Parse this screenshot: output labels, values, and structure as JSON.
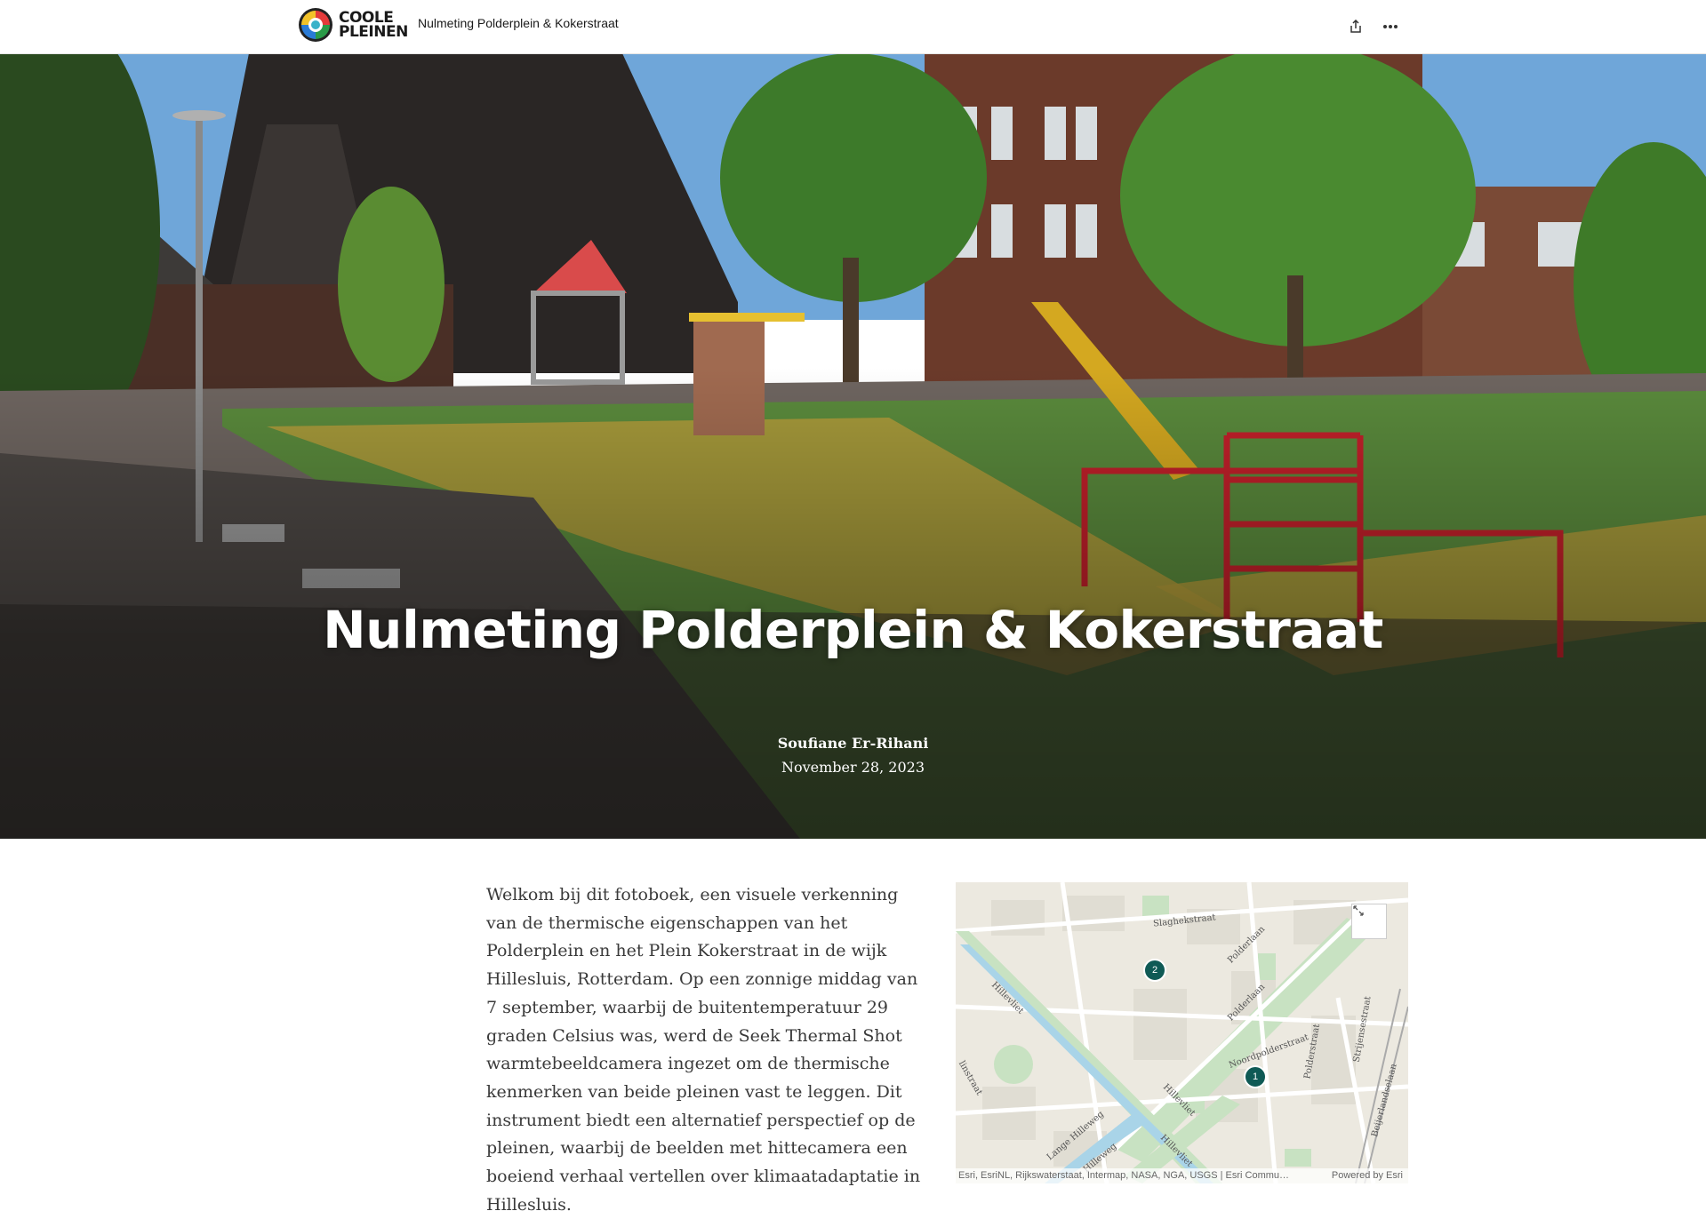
{
  "header": {
    "logo_line1": "COOLE",
    "logo_line2": "PLEINEN",
    "story_title": "Nulmeting Polderplein & Kokerstraat",
    "share_icon": "share-icon",
    "more_icon": "more-options-icon"
  },
  "hero": {
    "title": "Nulmeting Polderplein & Kokerstraat",
    "author": "Soufiane Er-Rihani",
    "date": "November 28, 2023"
  },
  "intro": {
    "text": "Welkom bij dit fotoboek, een visuele verkenning van de thermische eigenschappen van het Polderplein en het Plein Kokerstraat in de wijk Hillesluis, Rotterdam. Op een zonnige middag van 7 september, waarbij de buitentemperatuur 29 graden Celsius was, werd de Seek Thermal Shot warmtebeeldcamera ingezet om de thermische kenmerken van beide pleinen vast te leggen. Dit instrument biedt een alternatief perspectief op de pleinen, waarbij de beelden met hittecamera een boeiend verhaal vertellen over klimaatadaptatie in Hillesluis."
  },
  "map": {
    "expand_icon": "expand-icon",
    "markers": [
      "1",
      "2"
    ],
    "streets": {
      "slaghekstraat": "Slaghekstraat",
      "polderlaan1": "Polderlaan",
      "polderlaan2": "Polderlaan",
      "hillevliet1": "Hillevliet",
      "hillevliet2": "Hillevliet",
      "hillevliet3": "Hillevliet",
      "noordpolderstraat": "Noordpolderstraat",
      "polderstraat": "Polderstraat",
      "strijensestraat": "Strijensestraat",
      "beijerlandselaan": "Beijerlandselaan",
      "langehilleweg": "Lange Hilleweg",
      "hilleweg": "Hilleweg",
      "linstraat": "linstraat"
    },
    "attribution": "Esri, EsriNL, Rijkswaterstaat, Intermap, NASA, NGA, USGS | Esri Commu…",
    "powered_by": "Powered by Esri"
  },
  "colors": {
    "marker": "#0f5a55",
    "map_water": "#a9d4e8",
    "map_park": "#c8e2c2"
  }
}
